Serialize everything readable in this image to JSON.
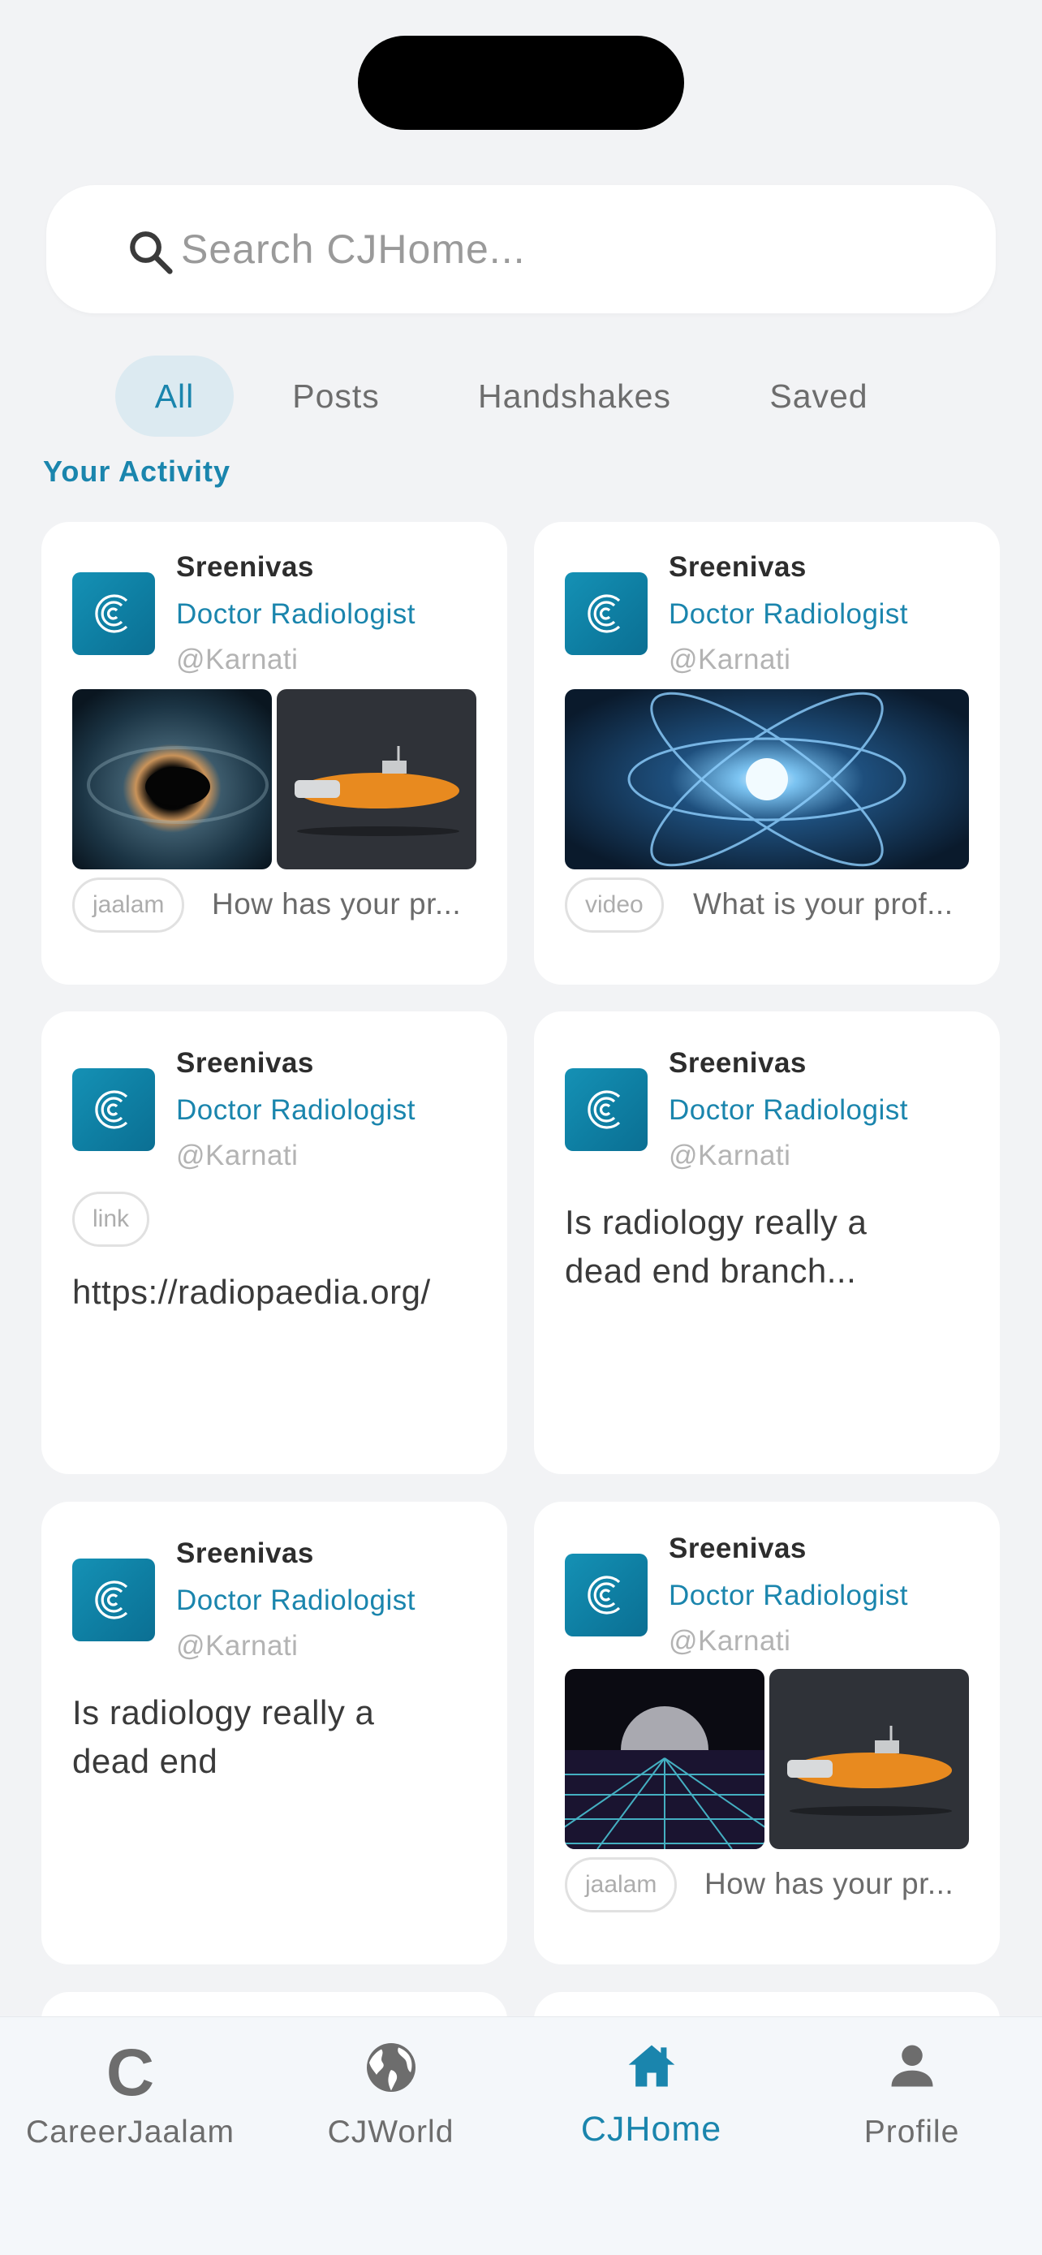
{
  "search": {
    "placeholder": "Search CJHome...",
    "icon": "search-icon"
  },
  "tabs": [
    {
      "label": "All",
      "active": true
    },
    {
      "label": "Posts",
      "active": false
    },
    {
      "label": "Handshakes",
      "active": false
    },
    {
      "label": "Saved",
      "active": false
    }
  ],
  "section_title": "Your Activity",
  "cards": [
    {
      "name": "Sreenivas",
      "role": "Doctor Radiologist",
      "handle": "@Karnati",
      "tag": "jaalam",
      "snippet": "How has your pr...",
      "images": [
        "black-hole-image",
        "submarine-image"
      ]
    },
    {
      "name": "Sreenivas",
      "role": "Doctor Radiologist",
      "handle": "@Karnati",
      "tag": "video",
      "snippet": "What is your prof...",
      "images": [
        "atom-image"
      ]
    },
    {
      "name": "Sreenivas",
      "role": "Doctor Radiologist",
      "handle": "@Karnati",
      "tag": "link",
      "body": "https://radiopaedia.org/"
    },
    {
      "name": "Sreenivas",
      "role": "Doctor Radiologist",
      "handle": "@Karnati",
      "body": "Is radiology really a dead end branch..."
    },
    {
      "name": "Sreenivas",
      "role": "Doctor Radiologist",
      "handle": "@Karnati",
      "body": "Is radiology really a dead end"
    },
    {
      "name": "Sreenivas",
      "role": "Doctor Radiologist",
      "handle": "@Karnati",
      "tag": "jaalam",
      "snippet": "How has your pr...",
      "images": [
        "moon-grid-image",
        "submarine-image"
      ]
    }
  ],
  "bottom_nav": [
    {
      "label": "CareerJaalam",
      "icon": "careerjaalam-c-icon",
      "glyph": "C",
      "active": false
    },
    {
      "label": "CJWorld",
      "icon": "globe-icon",
      "active": false
    },
    {
      "label": "CJHome",
      "icon": "home-icon",
      "active": true
    },
    {
      "label": "Profile",
      "icon": "person-icon",
      "active": false
    }
  ],
  "colors": {
    "accent": "#1a85ad",
    "tab_active_bg": "#dceaf1",
    "background": "#f2f3f5"
  }
}
